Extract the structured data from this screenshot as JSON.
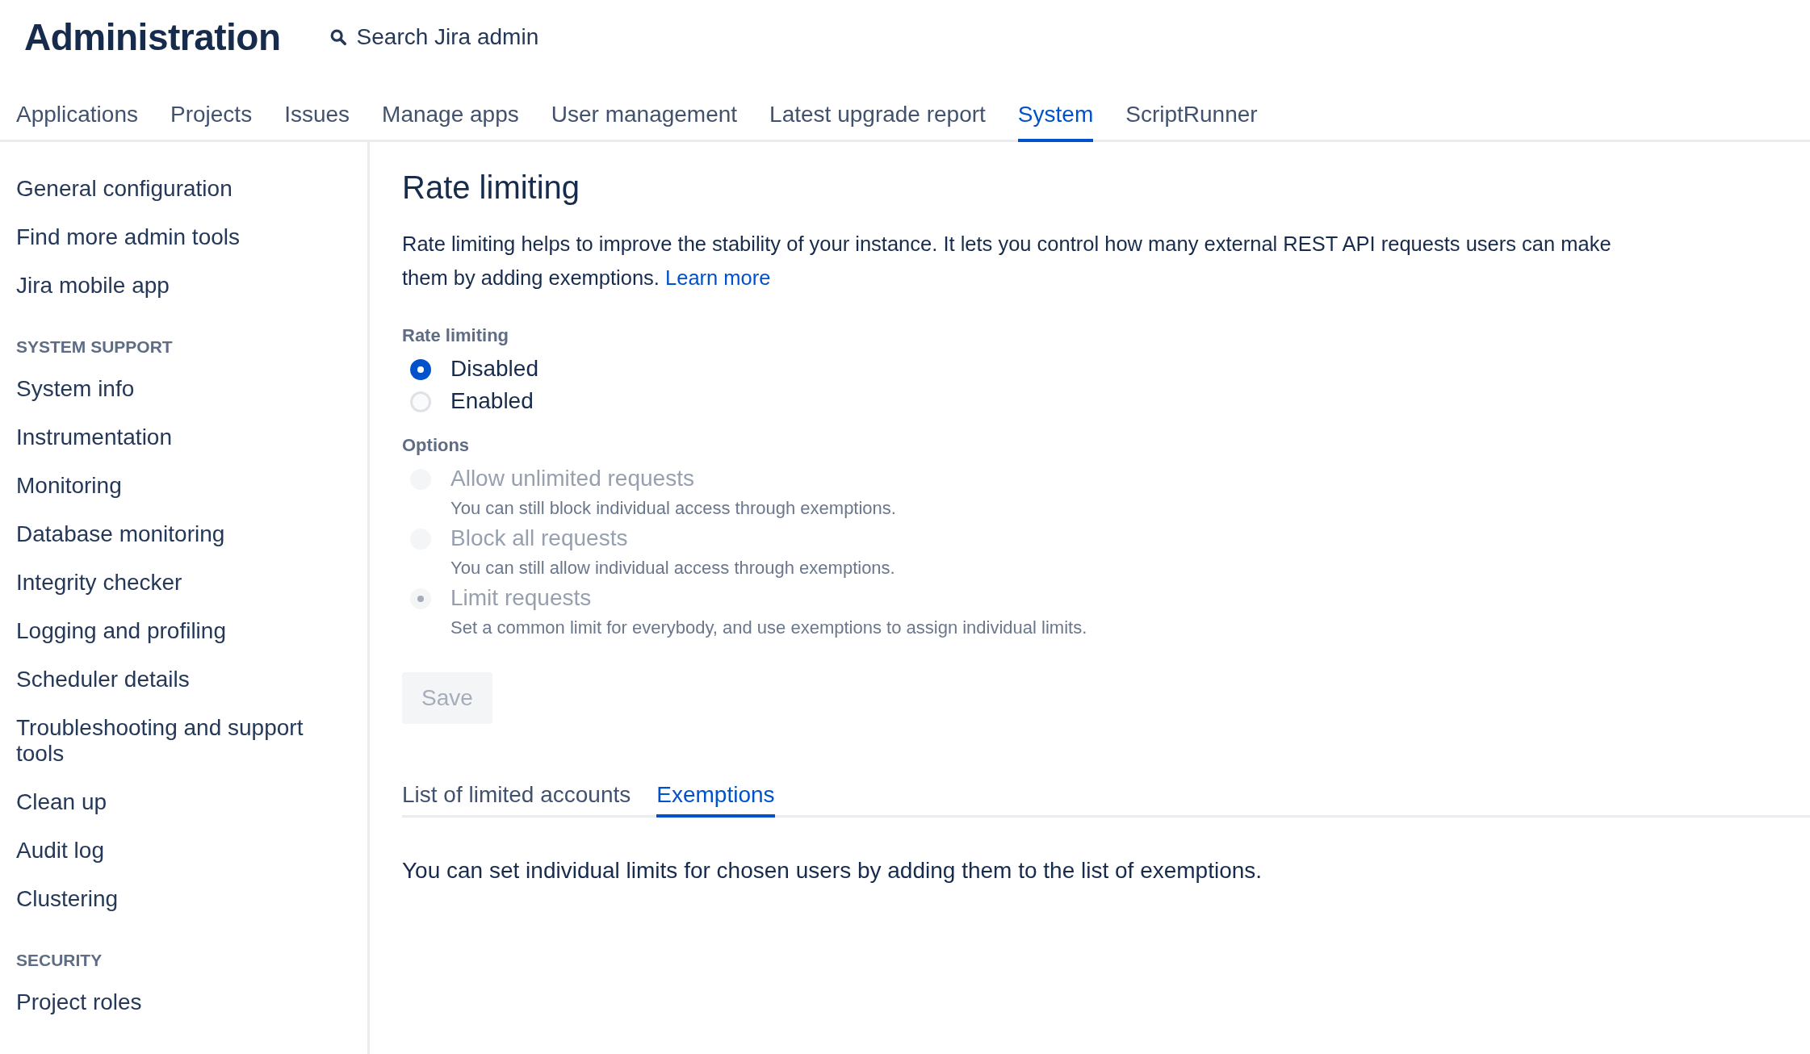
{
  "header": {
    "title": "Administration",
    "search": {
      "placeholder": "Search Jira admin"
    }
  },
  "nav_tabs": [
    {
      "label": "Applications",
      "selected": false
    },
    {
      "label": "Projects",
      "selected": false
    },
    {
      "label": "Issues",
      "selected": false
    },
    {
      "label": "Manage apps",
      "selected": false
    },
    {
      "label": "User management",
      "selected": false
    },
    {
      "label": "Latest upgrade report",
      "selected": false
    },
    {
      "label": "System",
      "selected": true
    },
    {
      "label": "ScriptRunner",
      "selected": false
    }
  ],
  "sidebar": {
    "sections": [
      {
        "items": [
          "General configuration",
          "Find more admin tools",
          "Jira mobile app"
        ]
      },
      {
        "heading": "SYSTEM SUPPORT",
        "items": [
          "System info",
          "Instrumentation",
          "Monitoring",
          "Database monitoring",
          "Integrity checker",
          "Logging and profiling",
          "Scheduler details",
          "Troubleshooting and support tools",
          "Clean up",
          "Audit log",
          "Clustering"
        ]
      },
      {
        "heading": "SECURITY",
        "items": [
          "Project roles"
        ]
      }
    ]
  },
  "main": {
    "title": "Rate limiting",
    "intro_lines": [
      "Rate limiting helps to improve the stability of your instance. It lets you control how many external REST API requests users can make",
      "them by adding exemptions."
    ],
    "intro_link": "Learn more",
    "rate_limiting": {
      "label": "Rate limiting",
      "options": [
        {
          "label": "Disabled",
          "selected": true,
          "disabled": false
        },
        {
          "label": "Enabled",
          "selected": false,
          "disabled": false
        }
      ]
    },
    "options": {
      "label": "Options",
      "options": [
        {
          "label": "Allow unlimited requests",
          "description": "You can still block individual access through exemptions.",
          "selected": false,
          "disabled": true
        },
        {
          "label": "Block all requests",
          "description": "You can still allow individual access through exemptions.",
          "selected": false,
          "disabled": true
        },
        {
          "label": "Limit requests",
          "description": "Set a common limit for everybody, and use exemptions to assign individual limits.",
          "selected": true,
          "disabled": true
        }
      ]
    },
    "save_button": {
      "label": "Save",
      "disabled": true
    },
    "tabs": [
      {
        "label": "List of limited accounts",
        "selected": false
      },
      {
        "label": "Exemptions",
        "selected": true
      }
    ],
    "tab_text": "You can set individual limits for chosen users by adding them to the list of exemptions."
  }
}
